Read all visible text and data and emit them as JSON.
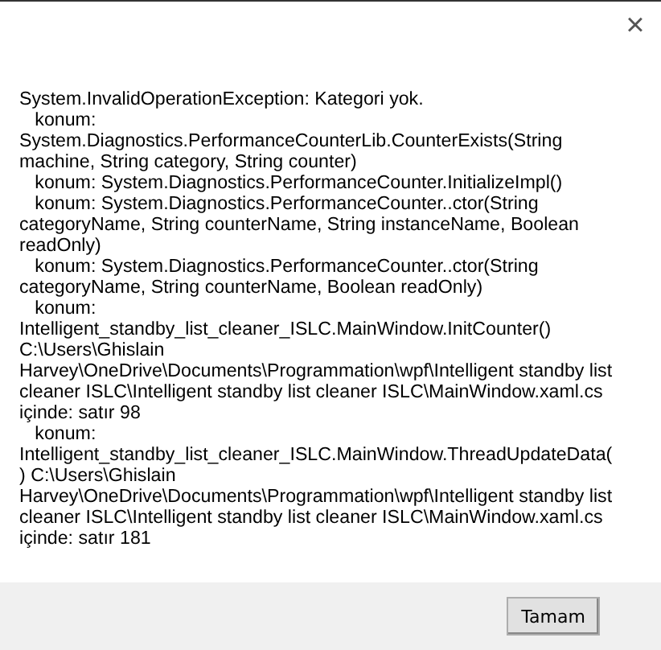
{
  "close_button": "×",
  "message": "System.InvalidOperationException: Kategori yok.\n   konum: System.Diagnostics.PerformanceCounterLib.CounterExists(String machine, String category, String counter)\n   konum: System.Diagnostics.PerformanceCounter.InitializeImpl()\n   konum: System.Diagnostics.PerformanceCounter..ctor(String categoryName, String counterName, String instanceName, Boolean readOnly)\n   konum: System.Diagnostics.PerformanceCounter..ctor(String categoryName, String counterName, Boolean readOnly)\n   konum: Intelligent_standby_list_cleaner_ISLC.MainWindow.InitCounter() C:\\Users\\Ghislain Harvey\\OneDrive\\Documents\\Programmation\\wpf\\Intelligent standby list cleaner ISLC\\Intelligent standby list cleaner ISLC\\MainWindow.xaml.cs içinde: satır 98\n   konum: Intelligent_standby_list_cleaner_ISLC.MainWindow.ThreadUpdateData() C:\\Users\\Ghislain Harvey\\OneDrive\\Documents\\Programmation\\wpf\\Intelligent standby list cleaner ISLC\\Intelligent standby list cleaner ISLC\\MainWindow.xaml.cs içinde: satır 181",
  "buttons": [
    "Tamam"
  ]
}
